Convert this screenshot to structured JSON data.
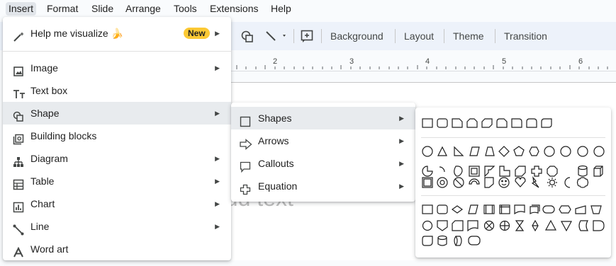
{
  "menubar": {
    "items": [
      {
        "label": "Insert",
        "active": true
      },
      {
        "label": "Format"
      },
      {
        "label": "Slide"
      },
      {
        "label": "Arrange"
      },
      {
        "label": "Tools"
      },
      {
        "label": "Extensions"
      },
      {
        "label": "Help"
      }
    ]
  },
  "toolbar": {
    "background_label": "Background",
    "layout_label": "Layout",
    "theme_label": "Theme",
    "transition_label": "Transition"
  },
  "ruler": {
    "numbers": [
      "2",
      "3",
      "4",
      "5",
      "6"
    ]
  },
  "canvas": {
    "placeholder_text": "add text"
  },
  "insert_menu": {
    "help_visualize": {
      "label": "Help me visualize 🍌",
      "badge": "New"
    },
    "items": [
      {
        "label": "Image",
        "icon": "image-icon",
        "has_submenu": true
      },
      {
        "label": "Text box",
        "icon": "text-box-icon",
        "has_submenu": false
      },
      {
        "label": "Shape",
        "icon": "shape-icon",
        "has_submenu": true,
        "highlighted": true
      },
      {
        "label": "Building blocks",
        "icon": "building-blocks-icon",
        "has_submenu": false
      },
      {
        "label": "Diagram",
        "icon": "diagram-icon",
        "has_submenu": true
      },
      {
        "label": "Table",
        "icon": "table-icon",
        "has_submenu": true
      },
      {
        "label": "Chart",
        "icon": "chart-icon",
        "has_submenu": true
      },
      {
        "label": "Line",
        "icon": "line-icon",
        "has_submenu": true
      },
      {
        "label": "Word art",
        "icon": "word-art-icon",
        "has_submenu": false
      }
    ]
  },
  "shape_submenu": {
    "items": [
      {
        "label": "Shapes",
        "icon": "square-icon",
        "highlighted": true
      },
      {
        "label": "Arrows",
        "icon": "arrow-icon"
      },
      {
        "label": "Callouts",
        "icon": "callout-icon"
      },
      {
        "label": "Equation",
        "icon": "plus-icon"
      }
    ]
  },
  "colors": {
    "accent": "#1a73e8",
    "badge": "#fcc934",
    "highlight": "#e8ebee",
    "menubar_active": "#e1e5ea"
  }
}
